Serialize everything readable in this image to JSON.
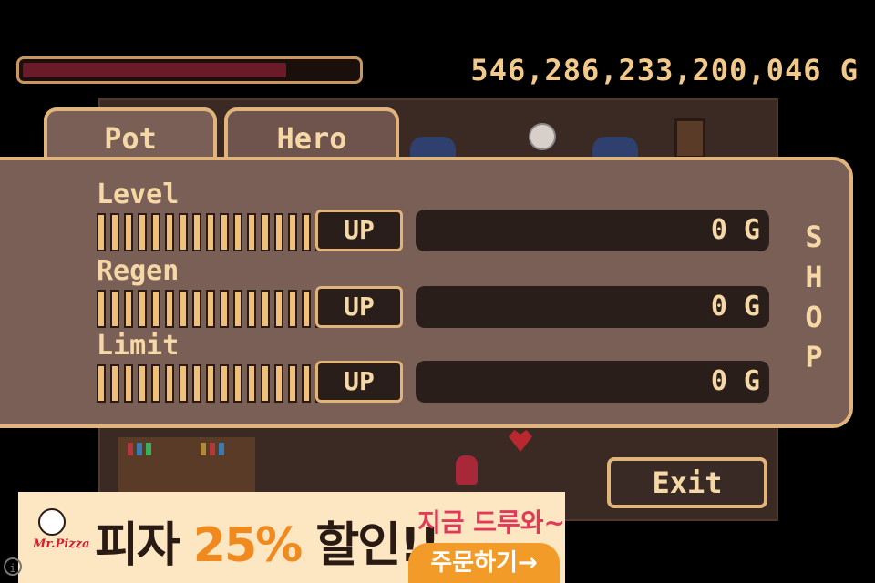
{
  "hud": {
    "hp_fraction": 0.79,
    "gold": "546,286,233,200,046 G"
  },
  "tabs": [
    {
      "label": "Pot",
      "active": true
    },
    {
      "label": "Hero",
      "active": false
    }
  ],
  "stats": [
    {
      "label": "Level",
      "up_label": "UP",
      "cost": "0 G"
    },
    {
      "label": "Regen",
      "up_label": "UP",
      "cost": "0 G"
    },
    {
      "label": "Limit",
      "up_label": "UP",
      "cost": "0 G"
    }
  ],
  "shop": {
    "letters": [
      "S",
      "H",
      "O",
      "P"
    ]
  },
  "exit_label": "Exit",
  "ad": {
    "brand": "Mr.Pizza",
    "headline_pre": "피자",
    "headline_pct": "25%",
    "headline_post": "할인!!",
    "sub": "지금 드루와~",
    "cta": "주문하기→"
  },
  "colors": {
    "accent": "#e0b47a",
    "panel": "#7a5f57",
    "hp": "#6b1a2a",
    "background": "#000000"
  }
}
